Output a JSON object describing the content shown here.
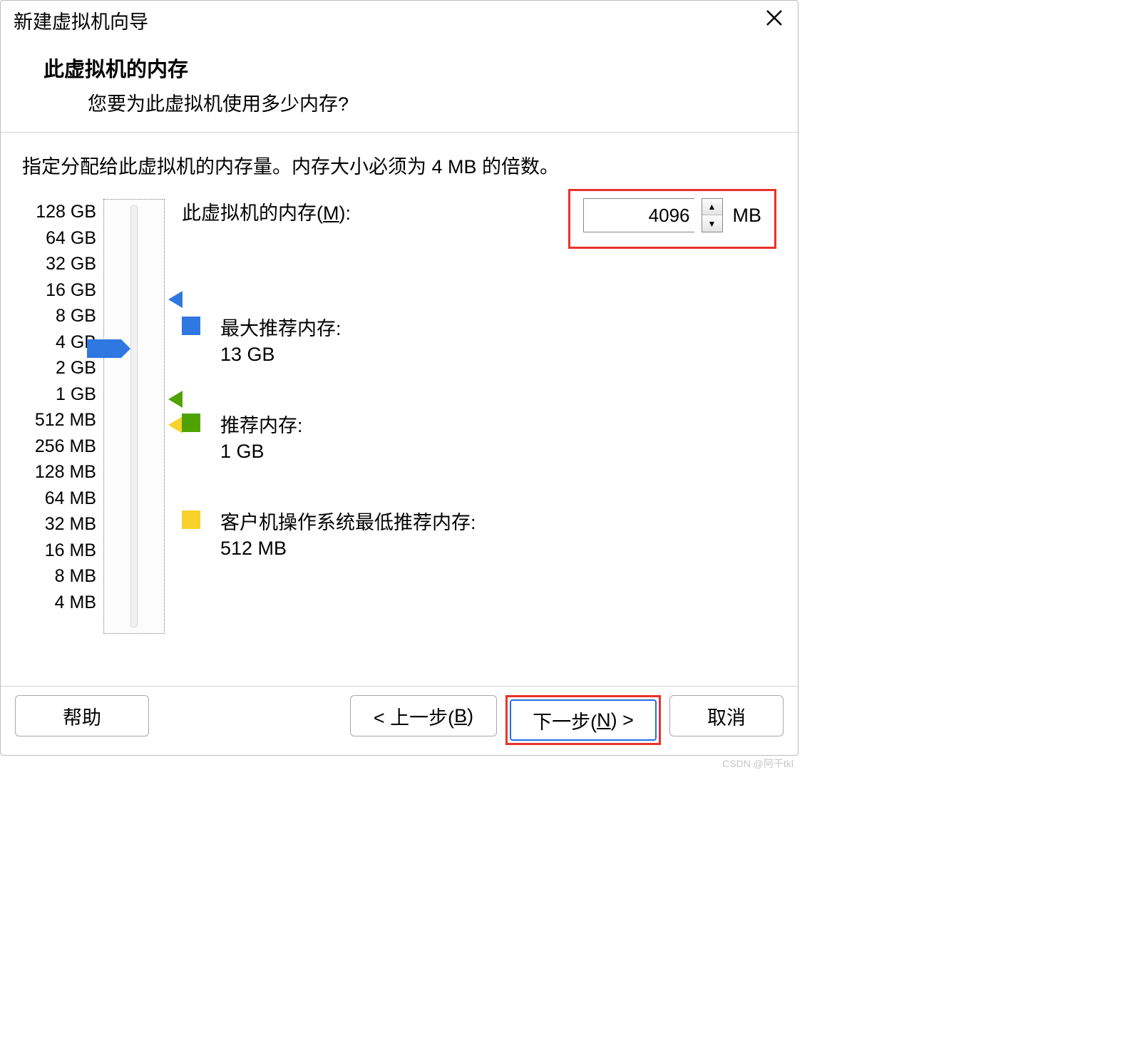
{
  "window": {
    "title": "新建虚拟机向导"
  },
  "header": {
    "h1": "此虚拟机的内存",
    "h2": "您要为此虚拟机使用多少内存?"
  },
  "instruction": "指定分配给此虚拟机的内存量。内存大小必须为 4 MB 的倍数。",
  "memory": {
    "label_prefix": "此虚拟机的内存(",
    "label_mnemonic": "M",
    "label_suffix": "):",
    "value": "4096",
    "unit": "MB"
  },
  "scale": {
    "ticks": [
      "128 GB",
      "64 GB",
      "32 GB",
      "16 GB",
      "8 GB",
      "4 GB",
      "2 GB",
      "1 GB",
      "512 MB",
      "256 MB",
      "128 MB",
      "64 MB",
      "32 MB",
      "16 MB",
      "8 MB",
      "4 MB"
    ]
  },
  "legend": {
    "max": {
      "title": "最大推荐内存:",
      "value": "13 GB"
    },
    "rec": {
      "title": "推荐内存:",
      "value": "1 GB"
    },
    "min": {
      "title": "客户机操作系统最低推荐内存:",
      "value": "512 MB"
    }
  },
  "buttons": {
    "help": "帮助",
    "back_prefix": "< 上一步(",
    "back_mnemonic": "B",
    "back_suffix": ")",
    "next_prefix": "下一步(",
    "next_mnemonic": "N",
    "next_suffix": ") >",
    "cancel": "取消"
  },
  "watermark": "CSDN @阿干tkl"
}
